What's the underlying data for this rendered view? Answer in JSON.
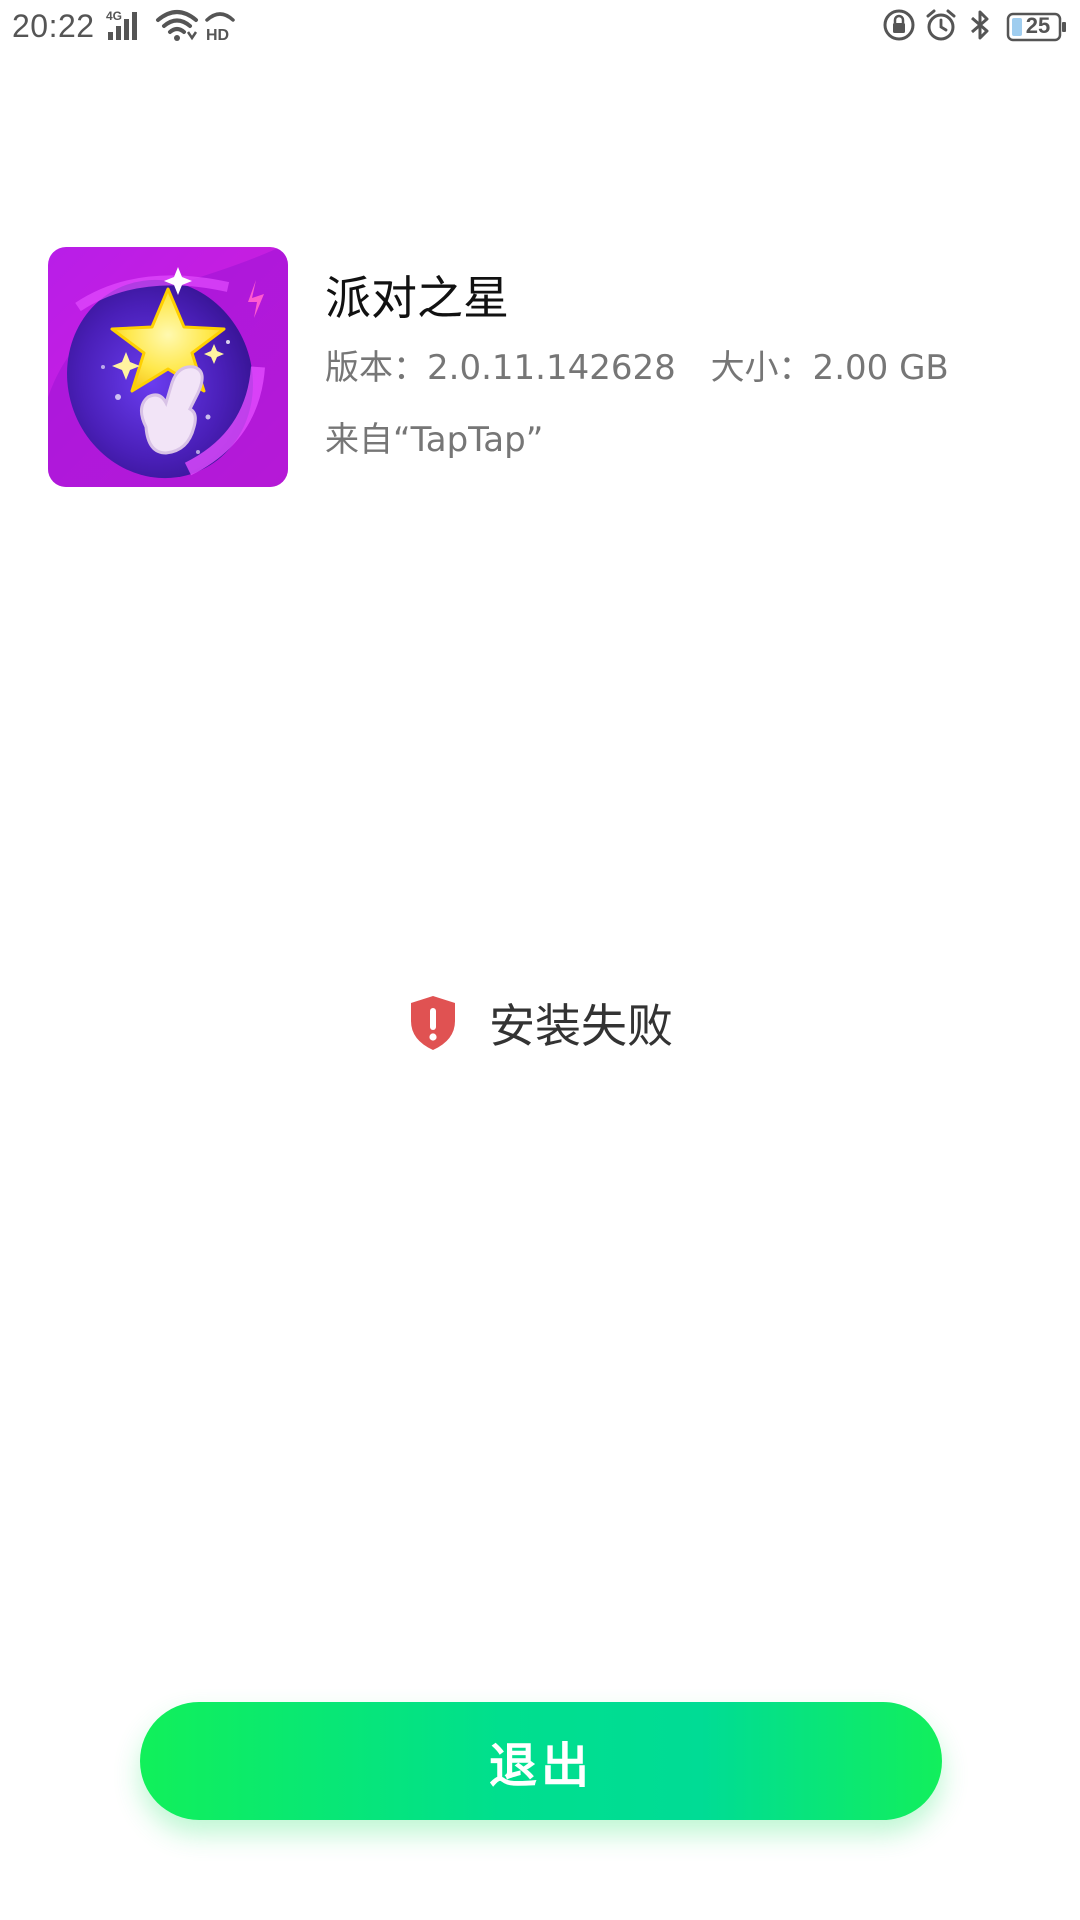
{
  "status_bar": {
    "time": "20:22",
    "network_label": "4G",
    "hd_label": "HD",
    "battery_level": "25",
    "icons": [
      "signal-icon",
      "wifi-icon",
      "hd-icon",
      "rotation-lock-icon",
      "alarm-icon",
      "bluetooth-icon",
      "battery-icon"
    ]
  },
  "app": {
    "name": "派对之星",
    "version_text": "版本：2.0.11.142628",
    "size_text": "大小：2.00 GB",
    "source_text": "来自“TapTap”",
    "icon": "party-star-app-icon"
  },
  "install_status": {
    "text": "安装失败",
    "icon": "shield-alert-icon",
    "color": "#e05252"
  },
  "actions": {
    "exit_label": "退出",
    "exit_color": "#00df8e"
  }
}
